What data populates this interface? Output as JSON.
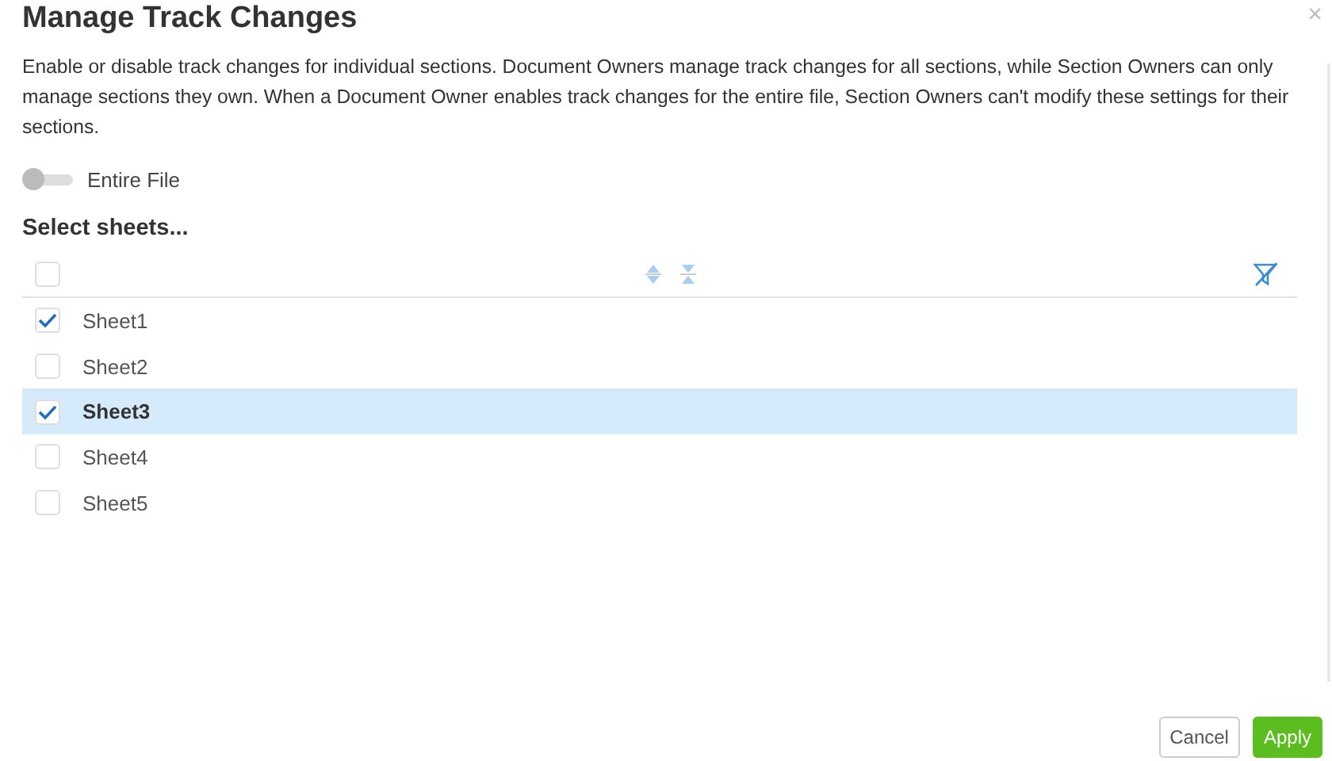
{
  "dialog": {
    "title": "Manage Track Changes",
    "close": "×",
    "description": "Enable or disable track changes for individual sections. Document Owners manage track changes for all sections, while Section Owners can only manage sections they own. When a Document Owner enables track changes for the entire file, Section Owners can't modify these settings for their sections."
  },
  "entire_file": {
    "label": "Entire File",
    "on": false
  },
  "sheets": {
    "heading": "Select sheets...",
    "select_all_checked": false,
    "rows": [
      {
        "name": "Sheet1",
        "checked": true,
        "selected": false
      },
      {
        "name": "Sheet2",
        "checked": false,
        "selected": false
      },
      {
        "name": "Sheet3",
        "checked": true,
        "selected": true
      },
      {
        "name": "Sheet4",
        "checked": false,
        "selected": false
      },
      {
        "name": "Sheet5",
        "checked": false,
        "selected": false
      }
    ]
  },
  "buttons": [
    {
      "label": "Cancel",
      "kind": "secondary"
    },
    {
      "label": "Apply",
      "kind": "primary"
    }
  ]
}
